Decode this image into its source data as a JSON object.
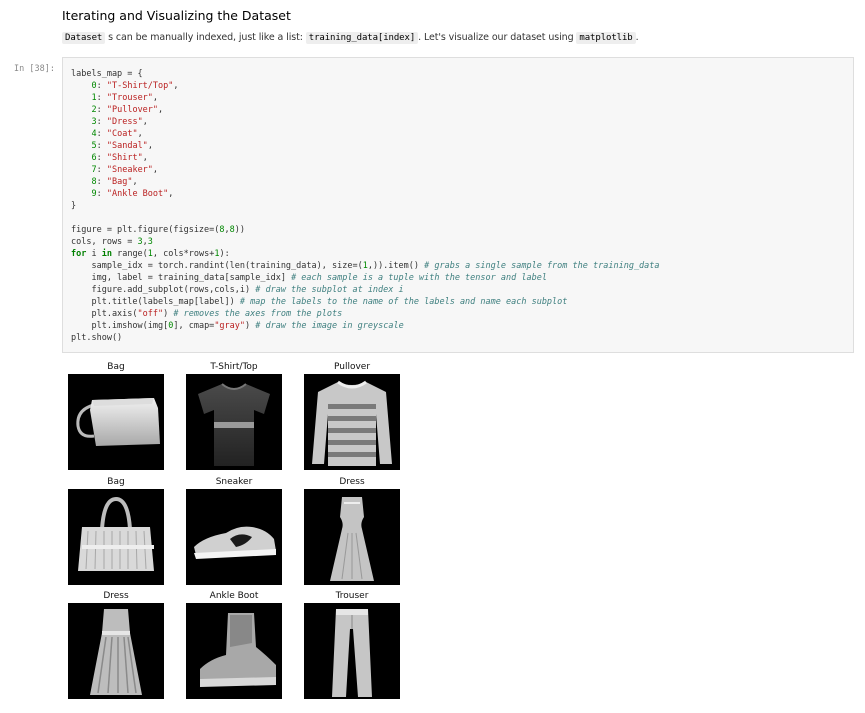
{
  "markdown": {
    "heading": "Iterating and Visualizing the Dataset",
    "para_code_dataset": "Dataset",
    "para_text_1": " s can be manually indexed, just like a list: ",
    "para_code_index": "training_data[index]",
    "para_text_2": ". Let's visualize our dataset using ",
    "para_code_lib": "matplotlib",
    "para_text_3": "."
  },
  "cell": {
    "prompt": "In [38]:"
  },
  "code": {
    "l1": "labels_map = {",
    "map": [
      {
        "key": "0",
        "value": "\"T-Shirt/Top\""
      },
      {
        "key": "1",
        "value": "\"Trouser\""
      },
      {
        "key": "2",
        "value": "\"Pullover\""
      },
      {
        "key": "3",
        "value": "\"Dress\""
      },
      {
        "key": "4",
        "value": "\"Coat\""
      },
      {
        "key": "5",
        "value": "\"Sandal\""
      },
      {
        "key": "6",
        "value": "\"Shirt\""
      },
      {
        "key": "7",
        "value": "\"Sneaker\""
      },
      {
        "key": "8",
        "value": "\"Bag\""
      },
      {
        "key": "9",
        "value": "\"Ankle Boot\""
      }
    ],
    "close_brace": "}",
    "fig_a": "figure = plt.figure(figsize=(",
    "fig_n1": "8",
    "fig_b": ",",
    "fig_n2": "8",
    "fig_c": "))",
    "cols_a": "cols, rows = ",
    "cols_n1": "3",
    "cols_b": ",",
    "cols_n2": "3",
    "for_kw": "for",
    "for_a": " i ",
    "for_in": "in",
    "for_b": " range(",
    "for_n1": "1",
    "for_c": ", cols*rows+",
    "for_n2": "1",
    "for_d": "):",
    "s1": "    sample_idx = torch.randint(len(training_data), size=(",
    "s1_n": "1",
    "s1_b": ",)).item() ",
    "s1_c": "# grabs a single sample from the training_data",
    "s2": "    img, label = training_data[sample_idx] ",
    "s2_c": "# each sample is a tuple with the tensor and label",
    "s3": "    figure.add_subplot(rows,cols,i) ",
    "s3_c": "# draw the subplot at index i",
    "s4": "    plt.title(labels_map[label]) ",
    "s4_c": "# map the labels to the name of the labels and name each subplot",
    "s5": "    plt.axis(",
    "s5_s": "\"off\"",
    "s5_b": ") ",
    "s5_c": "# removes the axes from the plots",
    "s6": "    plt.imshow(img[",
    "s6_n": "0",
    "s6_b": "], cmap=",
    "s6_s": "\"gray\"",
    "s6_c2": ") ",
    "s6_c": "# draw the image in greyscale",
    "show": "plt.show()"
  },
  "output": {
    "tiles": [
      {
        "title": "Bag",
        "icon": "bag"
      },
      {
        "title": "T-Shirt/Top",
        "icon": "tshirt"
      },
      {
        "title": "Pullover",
        "icon": "pullover"
      },
      {
        "title": "Bag",
        "icon": "handbag"
      },
      {
        "title": "Sneaker",
        "icon": "sneaker"
      },
      {
        "title": "Dress",
        "icon": "dress"
      },
      {
        "title": "Dress",
        "icon": "dress2"
      },
      {
        "title": "Ankle Boot",
        "icon": "boot"
      },
      {
        "title": "Trouser",
        "icon": "trouser"
      }
    ]
  }
}
